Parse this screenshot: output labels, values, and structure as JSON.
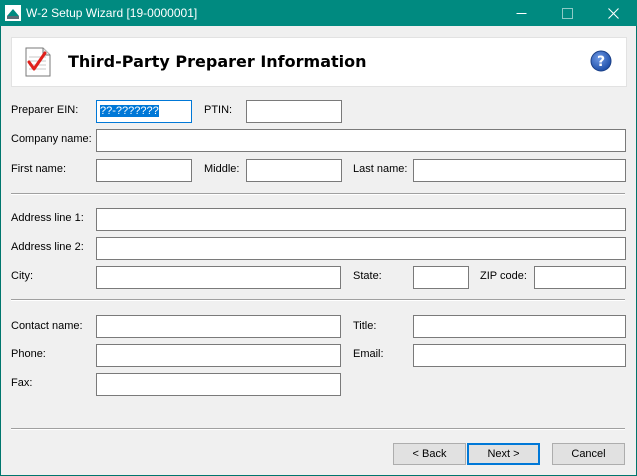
{
  "window": {
    "title": "W-2 Setup Wizard [19-0000001]",
    "app_icon": "app-logo-icon",
    "controls": [
      "minimize-icon",
      "maximize-icon",
      "close-icon"
    ]
  },
  "header": {
    "title": "Third-Party Preparer Information",
    "icon": "checklist-icon",
    "help_icon": "help-icon",
    "help_glyph": "?"
  },
  "form": {
    "preparer_ein": {
      "label": "Preparer EIN:",
      "value": "??-???????"
    },
    "ptin": {
      "label": "PTIN:",
      "value": ""
    },
    "company_name": {
      "label": "Company name:",
      "value": ""
    },
    "first_name": {
      "label": "First name:",
      "value": ""
    },
    "middle": {
      "label": "Middle:",
      "value": ""
    },
    "last_name": {
      "label": "Last name:",
      "value": ""
    },
    "address1": {
      "label": "Address line 1:",
      "value": ""
    },
    "address2": {
      "label": "Address line 2:",
      "value": ""
    },
    "city": {
      "label": "City:",
      "value": ""
    },
    "state": {
      "label": "State:",
      "value": ""
    },
    "zip": {
      "label": "ZIP code:",
      "value": ""
    },
    "contact_name": {
      "label": "Contact name:",
      "value": ""
    },
    "title": {
      "label": "Title:",
      "value": ""
    },
    "phone": {
      "label": "Phone:",
      "value": ""
    },
    "email": {
      "label": "Email:",
      "value": ""
    },
    "fax": {
      "label": "Fax:",
      "value": ""
    }
  },
  "buttons": {
    "back": "< Back",
    "next": "Next >",
    "cancel": "Cancel"
  },
  "colors": {
    "titlebar": "#008a80",
    "focus": "#0078d7",
    "selection": "#0078d7",
    "help_icon": "#1f4fa8"
  }
}
